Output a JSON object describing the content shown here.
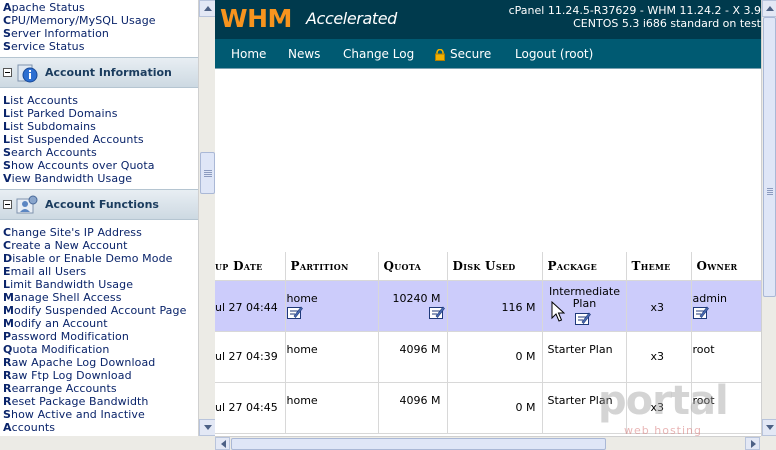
{
  "left_frame": {
    "top_links": [
      {
        "initial": "A",
        "rest": "pache Status"
      },
      {
        "initial": "C",
        "rest": "PU/Memory/MySQL Usage"
      },
      {
        "initial": "S",
        "rest": "erver Information"
      },
      {
        "initial": "S",
        "rest": "ervice Status"
      }
    ],
    "sections": [
      {
        "title": "Account Information",
        "icon": "info-icon",
        "links": [
          {
            "initial": "L",
            "rest": "ist Accounts"
          },
          {
            "initial": "L",
            "rest": "ist Parked Domains"
          },
          {
            "initial": "L",
            "rest": "ist Subdomains"
          },
          {
            "initial": "L",
            "rest": "ist Suspended Accounts"
          },
          {
            "initial": "S",
            "rest": "earch Accounts"
          },
          {
            "initial": "S",
            "rest": "how Accounts over Quota"
          },
          {
            "initial": "V",
            "rest": "iew Bandwidth Usage"
          }
        ]
      },
      {
        "title": "Account Functions",
        "icon": "account-functions-icon",
        "links": [
          {
            "initial": "C",
            "rest": "hange Site's IP Address"
          },
          {
            "initial": "C",
            "rest": "reate a New Account"
          },
          {
            "initial": "D",
            "rest": "isable or Enable Demo Mode"
          },
          {
            "initial": "E",
            "rest": "mail all Users"
          },
          {
            "initial": "L",
            "rest": "imit Bandwidth Usage"
          },
          {
            "initial": "M",
            "rest": "anage Shell Access"
          },
          {
            "initial": "M",
            "rest": "odify Suspended Account Page"
          },
          {
            "initial": "M",
            "rest": "odify an Account"
          },
          {
            "initial": "P",
            "rest": "assword Modification"
          },
          {
            "initial": "Q",
            "rest": "uota Modification"
          },
          {
            "initial": "R",
            "rest": "aw Apache Log Download"
          },
          {
            "initial": "R",
            "rest": "aw Ftp Log Download"
          },
          {
            "initial": "R",
            "rest": "earrange Accounts"
          },
          {
            "initial": "R",
            "rest": "eset Package Bandwidth"
          },
          {
            "initial": "S",
            "rest": "how Active and Inactive"
          },
          {
            "initial": "A",
            "rest": "ccounts"
          }
        ]
      }
    ]
  },
  "header": {
    "logo_main": "WHM",
    "logo_sub": "Accelerated",
    "version_line1": "cPanel 11.24.5-R37629 - WHM 11.24.2 - X 3.9",
    "version_line2": "CENTOS 5.3 i686 standard on test"
  },
  "nav": {
    "items": [
      "Home",
      "News",
      "Change Log",
      "Secure",
      "Logout (root)"
    ],
    "secure_icon": "lock-icon"
  },
  "table": {
    "headers": [
      "up Date",
      "Partition",
      "Quota",
      "Disk Used",
      "Package",
      "Theme",
      "Owner"
    ],
    "rows": [
      {
        "date": "ul 27 04:44",
        "partition": "home",
        "quota": "10240 M",
        "disk_used": "116 M",
        "package": "Intermediate Plan",
        "theme": "x3",
        "owner": "admin",
        "highlighted": true
      },
      {
        "date": "ul 27 04:39",
        "partition": "home",
        "quota": "4096 M",
        "disk_used": "0 M",
        "package": "Starter Plan",
        "theme": "x3",
        "owner": "root",
        "highlighted": false
      },
      {
        "date": "ul 27 04:45",
        "partition": "home",
        "quota": "4096 M",
        "disk_used": "0 M",
        "package": "Starter Plan",
        "theme": "x3",
        "owner": "root",
        "highlighted": false
      }
    ],
    "edit_icon": "edit-icon"
  },
  "watermark": {
    "main": "portal",
    "sub": "web hosting"
  },
  "colors": {
    "banner": "#003a4d",
    "nav": "#005a72",
    "logo_orange": "#f7941e",
    "highlight_row": "#ccccfb",
    "link": "#0a246a"
  }
}
